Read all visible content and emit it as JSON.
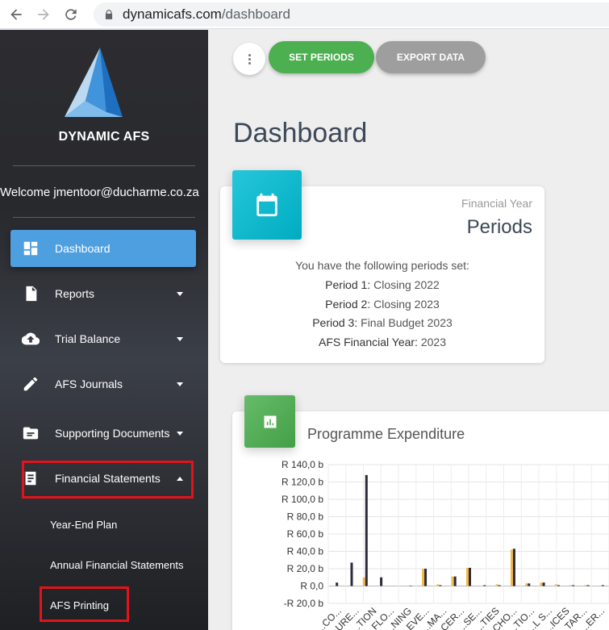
{
  "browser": {
    "url_host": "dynamicafs.com",
    "url_path": "/dashboard"
  },
  "sidebar": {
    "brand": "DYNAMIC AFS",
    "welcome": "Welcome jmentoor@ducharme.co.za",
    "items": [
      {
        "label": "Dashboard",
        "icon": "dashboard-icon",
        "active": true
      },
      {
        "label": "Reports",
        "icon": "report-icon",
        "caret": "down"
      },
      {
        "label": "Trial Balance",
        "icon": "cloud-upload-icon",
        "caret": "down"
      },
      {
        "label": "AFS Journals",
        "icon": "pencil-icon",
        "caret": "down"
      },
      {
        "label": "Supporting Documents",
        "icon": "folder-icon",
        "caret": "down"
      },
      {
        "label": "Financial Statements",
        "icon": "document-icon",
        "caret": "up"
      }
    ],
    "sub_items": [
      "Year-End Plan",
      "Annual Financial Statements",
      "AFS Printing"
    ]
  },
  "toolbar": {
    "set_periods": "SET PERIODS",
    "export_data": "EXPORT DATA"
  },
  "page_title": "Dashboard",
  "periods_card": {
    "label": "Financial Year",
    "title": "Periods",
    "intro": "You have the following periods set:",
    "lines": [
      {
        "key": "Period 1:",
        "value": " Closing 2022"
      },
      {
        "key": "Period 2:",
        "value": " Closing 2023"
      },
      {
        "key": "Period 3:",
        "value": " Final Budget 2023"
      },
      {
        "key": "AFS Financial Year:",
        "value": " 2023"
      }
    ]
  },
  "chart_card": {
    "title": "Programme Expenditure"
  },
  "colors": {
    "accent_blue": "#4e9fe0",
    "green": "#4caf50",
    "cyan": "#00acc1",
    "bar_orange": "#f5b944",
    "bar_dark": "#2b2b3a",
    "highlight_red": "#e3131b"
  },
  "chart_data": {
    "type": "bar",
    "title": "Programme Expenditure",
    "ylim": [
      -20,
      140
    ],
    "yticks": [
      -20,
      0,
      20,
      40,
      60,
      80,
      100,
      120,
      140
    ],
    "ytick_labels": [
      "-R 20,0 b",
      "R 0,0",
      "R 20,0 b",
      "R 40,0 b",
      "R 60,0 b",
      "R 80,0 b",
      "R 100,0 b",
      "R 120,0 b",
      "R 140,0 b"
    ],
    "categories": [
      "...CO...",
      "...URE...",
      "...TION",
      "...FLO...",
      "...NING",
      "...EVE...",
      "...MA...",
      "...CER...",
      "...SE...",
      "...TIES",
      "...CHO...",
      "...TIO...",
      "...L S...",
      "...ICES",
      "...TAR...",
      "...ER..."
    ],
    "series": [
      {
        "values": [
          0,
          0,
          10,
          0,
          0,
          0,
          20,
          2,
          11,
          21,
          0,
          2,
          42,
          3,
          4,
          2,
          1,
          1,
          0
        ]
      },
      {
        "values": [
          4,
          27,
          128,
          10,
          0,
          0.5,
          20,
          1,
          11,
          21,
          1,
          1,
          43,
          3,
          4,
          1,
          1,
          1,
          1
        ]
      }
    ],
    "legend": "none",
    "grid": true
  }
}
